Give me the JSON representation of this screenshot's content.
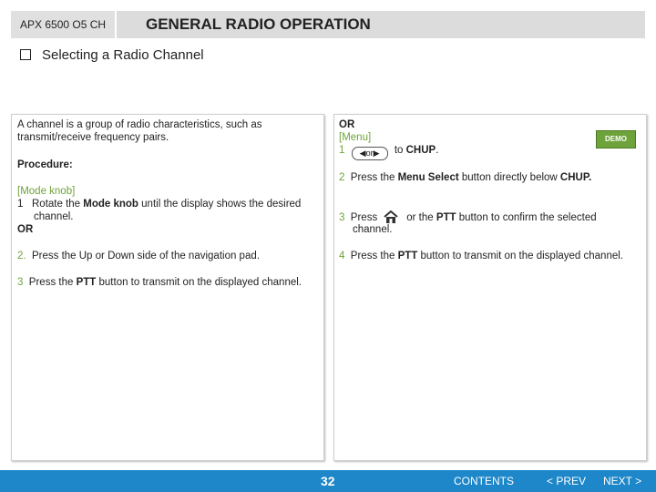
{
  "header": {
    "model": "APX 6500 O5 CH",
    "title": "GENERAL RADIO OPERATION"
  },
  "section": {
    "title": "Selecting a Radio Channel"
  },
  "left": {
    "intro": "A channel is a group of radio characteristics, such as transmit/receive frequency pairs.",
    "procedure": "Procedure:",
    "mode_knob": "[Mode knob]",
    "step1_num": "1",
    "step1_a": "Rotate the ",
    "step1_bold": "Mode knob",
    "step1_b": " until the display shows the desired",
    "step1_c": "channel.",
    "or": "OR",
    "step2_num": "2.",
    "step2": "Press the Up or Down side of the navigation pad.",
    "step3_num": "3",
    "step3_a": "Press the ",
    "step3_bold": "PTT",
    "step3_b": " button to transmit on the displayed channel."
  },
  "right": {
    "or": "OR",
    "menu": "[Menu]",
    "step1_num": "1",
    "step1_or": "or",
    "step1_to": "to ",
    "step1_bold": "CHUP",
    "step1_end": ".",
    "demo": "DEMO",
    "step2_num": "2",
    "step2_a": "Press the ",
    "step2_bold1": "Menu Select",
    "step2_b": " button directly below ",
    "step2_bold2": "CHUP.",
    "step3_num": "3",
    "step3_a": "Press",
    "step3_b": "or the ",
    "step3_bold": "PTT",
    "step3_c": " button to confirm the selected",
    "step3_d": "channel.",
    "step4_num": "4",
    "step4_a": "Press the ",
    "step4_bold": "PTT",
    "step4_b": " button to transmit on the displayed channel."
  },
  "footer": {
    "page": "32",
    "contents": "CONTENTS",
    "prev": "< PREV",
    "next": "NEXT >"
  },
  "colors": {
    "accent_green": "#6da33a",
    "footer_blue": "#1e87c9"
  },
  "icons": [
    "home-icon",
    "navigation-pad-icon"
  ]
}
